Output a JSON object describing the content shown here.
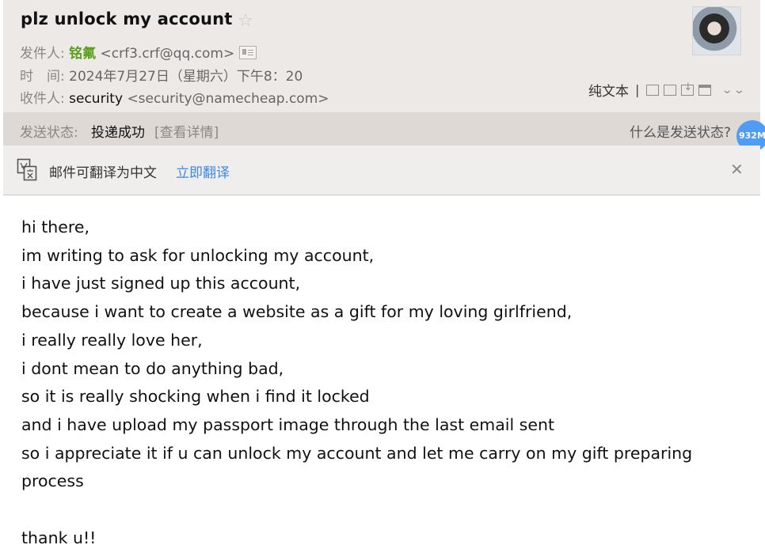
{
  "email": {
    "subject": "plz unlock my account",
    "star_glyph": "☆",
    "from_label": "发件人:",
    "from_name": "铭氟",
    "from_address": "<crf3.crf@qq.com>",
    "time_label": "时　间:",
    "time_value": "2024年7月27日（星期六）下午8：20",
    "to_label": "收件人:",
    "to_name": "security",
    "to_address": "<security@namecheap.com>"
  },
  "toolbar": {
    "plain_text": "纯文本",
    "separator": "|",
    "more_glyph": "⌄⌄"
  },
  "status": {
    "label": "发送状态:",
    "value": "投递成功",
    "detail": "[查看详情]",
    "help": "什么是发送状态?"
  },
  "badge": {
    "text": "932M"
  },
  "translate": {
    "message": "邮件可翻译为中文",
    "action": "立即翻译",
    "close_glyph": "✕"
  },
  "body": {
    "lines": [
      "hi there,",
      "im writing to ask for unlocking my account,",
      "i have just signed up this account,",
      "because i want to create a website as a gift for my loving girlfriend,",
      "i really really love her,",
      "i dont mean to do anything bad,",
      "so it is really shocking when i find it locked",
      "and i have upload my passport image through the last email sent",
      "so i appreciate it if u can unlock my account and let me carry on my gift preparing",
      "process",
      "",
      "thank u!!"
    ]
  },
  "icons": {
    "star": "star-icon",
    "vcard": "contact-card-icon",
    "translate": "translate-icon",
    "close": "close-icon"
  }
}
